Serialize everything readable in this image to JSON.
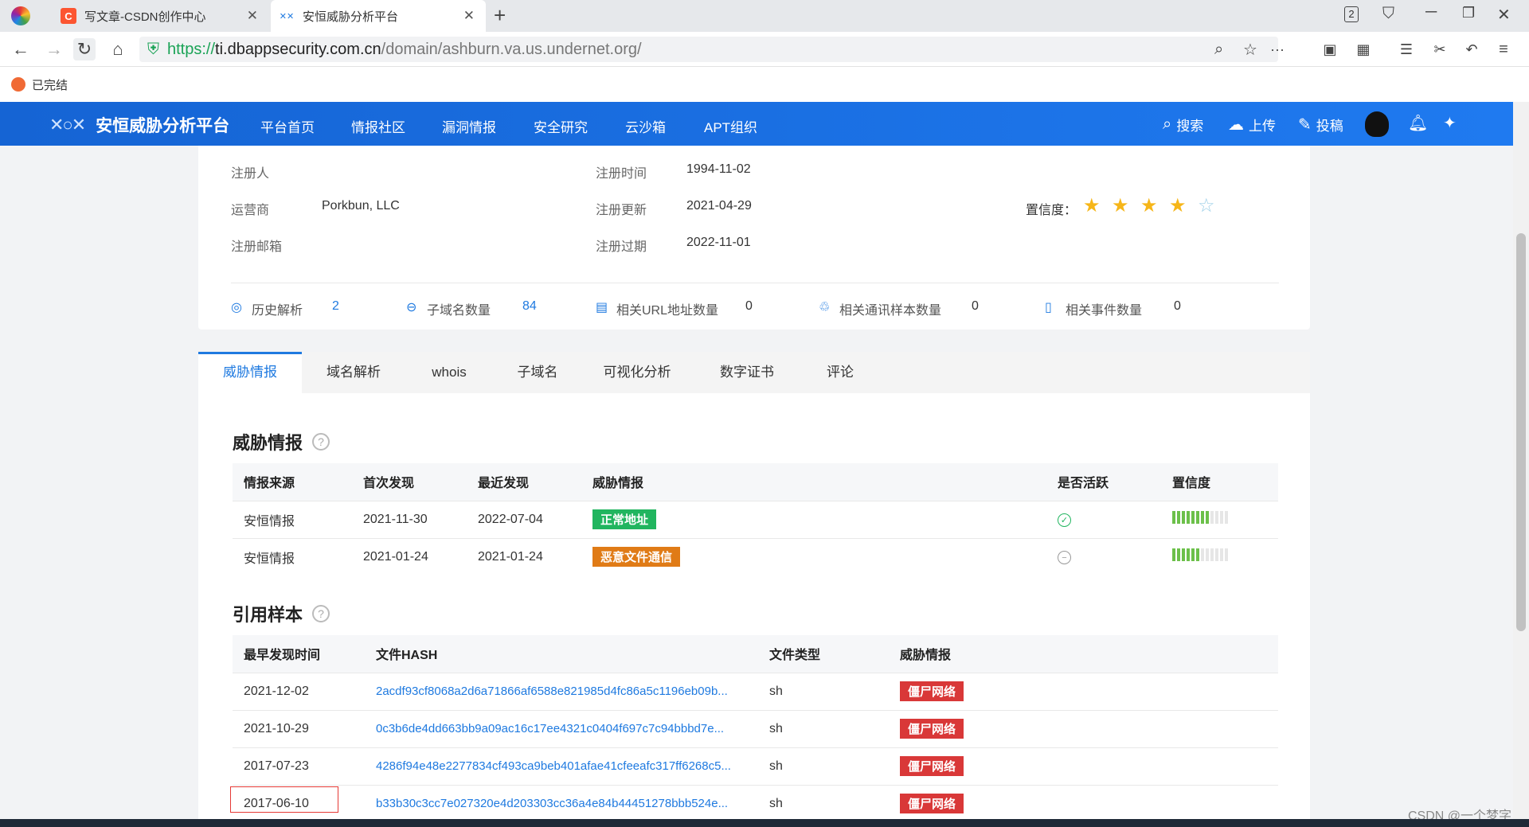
{
  "browser": {
    "tabs": [
      {
        "title": "写文章-CSDN创作中心",
        "icon": "csdn-icon"
      },
      {
        "title": "安恒威胁分析平台",
        "icon": "dbapp-icon"
      }
    ],
    "new_tab": "+",
    "tab_count_badge": "2",
    "url": {
      "proto": "https://",
      "host": "ti.dbappsecurity.com.cn",
      "path": "/domain/ashburn.va.us.undernet.org/"
    },
    "bookmark": "已完结"
  },
  "site": {
    "logo_text": "安恒威胁分析平台",
    "nav": [
      "平台首页",
      "情报社区",
      "漏洞情报",
      "安全研究",
      "云沙箱",
      "APT组织"
    ],
    "actions": {
      "search": "搜索",
      "upload": "上传",
      "submit": "投稿"
    }
  },
  "whois": {
    "registrant_label": "注册人",
    "registrar_label": "运营商",
    "registrar_value": "Porkbun, LLC",
    "email_label": "注册邮箱",
    "reg_time_label": "注册时间",
    "reg_time_value": "1994-11-02",
    "reg_update_label": "注册更新",
    "reg_update_value": "2021-04-29",
    "reg_expire_label": "注册过期",
    "reg_expire_value": "2022-11-01",
    "confidence_label": "置信度：",
    "confidence_stars": 4,
    "confidence_max": 5
  },
  "stats": [
    {
      "label": "历史解析",
      "value": "2",
      "icon": "globe-icon"
    },
    {
      "label": "子域名数量",
      "value": "84",
      "icon": "subdomain-icon"
    },
    {
      "label": "相关URL地址数量",
      "value": "0",
      "icon": "url-icon"
    },
    {
      "label": "相关通讯样本数量",
      "value": "0",
      "icon": "sample-icon"
    },
    {
      "label": "相关事件数量",
      "value": "0",
      "icon": "event-icon"
    }
  ],
  "tabs": [
    "威胁情报",
    "域名解析",
    "whois",
    "子域名",
    "可视化分析",
    "数字证书",
    "评论"
  ],
  "threat": {
    "title": "威胁情报",
    "headers": [
      "情报来源",
      "首次发现",
      "最近发现",
      "威胁情报",
      "是否活跃",
      "置信度"
    ],
    "rows": [
      {
        "source": "安恒情报",
        "first": "2021-11-30",
        "last": "2022-07-04",
        "tag": "正常地址",
        "tag_color": "#21b55f",
        "active": true,
        "confidence": 0.7
      },
      {
        "source": "安恒情报",
        "first": "2021-01-24",
        "last": "2021-01-24",
        "tag": "恶意文件通信",
        "tag_color": "#e07b16",
        "active": false,
        "confidence": 0.5
      }
    ]
  },
  "samples": {
    "title": "引用样本",
    "headers": [
      "最早发现时间",
      "文件HASH",
      "文件类型",
      "威胁情报"
    ],
    "rows": [
      {
        "time": "2021-12-02",
        "hash": "2acdf93cf8068a2d6a71866af6588e821985d4fc86a5c1196eb09b...",
        "type": "sh",
        "tag": "僵尸网络"
      },
      {
        "time": "2021-10-29",
        "hash": "0c3b6de4dd663bb9a09ac16c17ee4321c0404f697c7c94bbbd7e...",
        "type": "sh",
        "tag": "僵尸网络"
      },
      {
        "time": "2017-07-23",
        "hash": "4286f94e48e2277834cf493ca9beb401afae41cfeeafc317ff6268c5...",
        "type": "sh",
        "tag": "僵尸网络"
      },
      {
        "time": "2017-06-10",
        "hash": "b33b30c3cc7e027320e4d203303cc36a4e84b44451278bbb524e...",
        "type": "sh",
        "tag": "僵尸网络"
      }
    ],
    "tag_color": "#d93838"
  },
  "watermark": "CSDN @一个梦字"
}
